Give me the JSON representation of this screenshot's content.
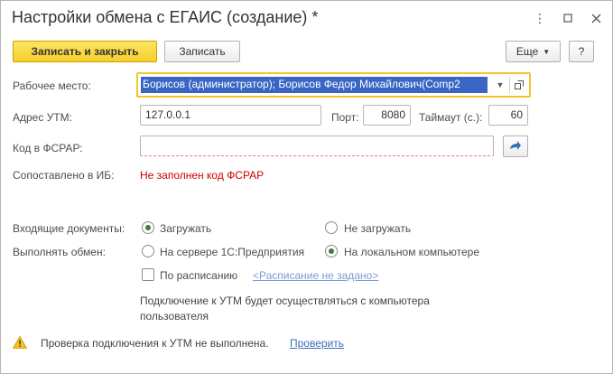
{
  "window": {
    "title": "Настройки обмена с ЕГАИС (создание) *",
    "more_icon": "more-vertical-icon",
    "maximize_icon": "maximize-icon",
    "close_icon": "close-icon"
  },
  "toolbar": {
    "save_close_label": "Записать и закрыть",
    "save_label": "Записать",
    "more_label": "Еще",
    "help_label": "?"
  },
  "form": {
    "workplace_label": "Рабочее место:",
    "workplace_value": "Борисов (администратор); Борисов Федор Михайлович(Comp2",
    "utm_address_label": "Адрес УТМ:",
    "utm_address_value": "127.0.0.1",
    "port_label": "Порт:",
    "port_value": "8080",
    "timeout_label": "Таймаут (с.):",
    "timeout_value": "60",
    "fsrar_label": "Код в ФСРАР:",
    "fsrar_value": "",
    "matched_label": "Сопоставлено в ИБ:",
    "matched_value": "Не заполнен код ФСРАР",
    "incoming_label": "Входящие документы:",
    "incoming_options": [
      "Загружать",
      "Не загружать"
    ],
    "exchange_label": "Выполнять обмен:",
    "exchange_options": [
      "На сервере 1С:Предприятия",
      "На локальном компьютере"
    ],
    "schedule_label": "По расписанию",
    "schedule_link": "<Расписание не задано>",
    "note_line1": "Подключение к УТМ будет осуществляться с компьютера",
    "note_line2": "пользователя",
    "warning_text": "Проверка подключения к УТМ не выполнена.",
    "check_link": "Проверить"
  },
  "colors": {
    "primary_button": "#f5cf2b",
    "selection": "#3966c4",
    "error": "#cc0000",
    "link": "#3d6fb5",
    "radio_dot": "#3c7d3c"
  }
}
